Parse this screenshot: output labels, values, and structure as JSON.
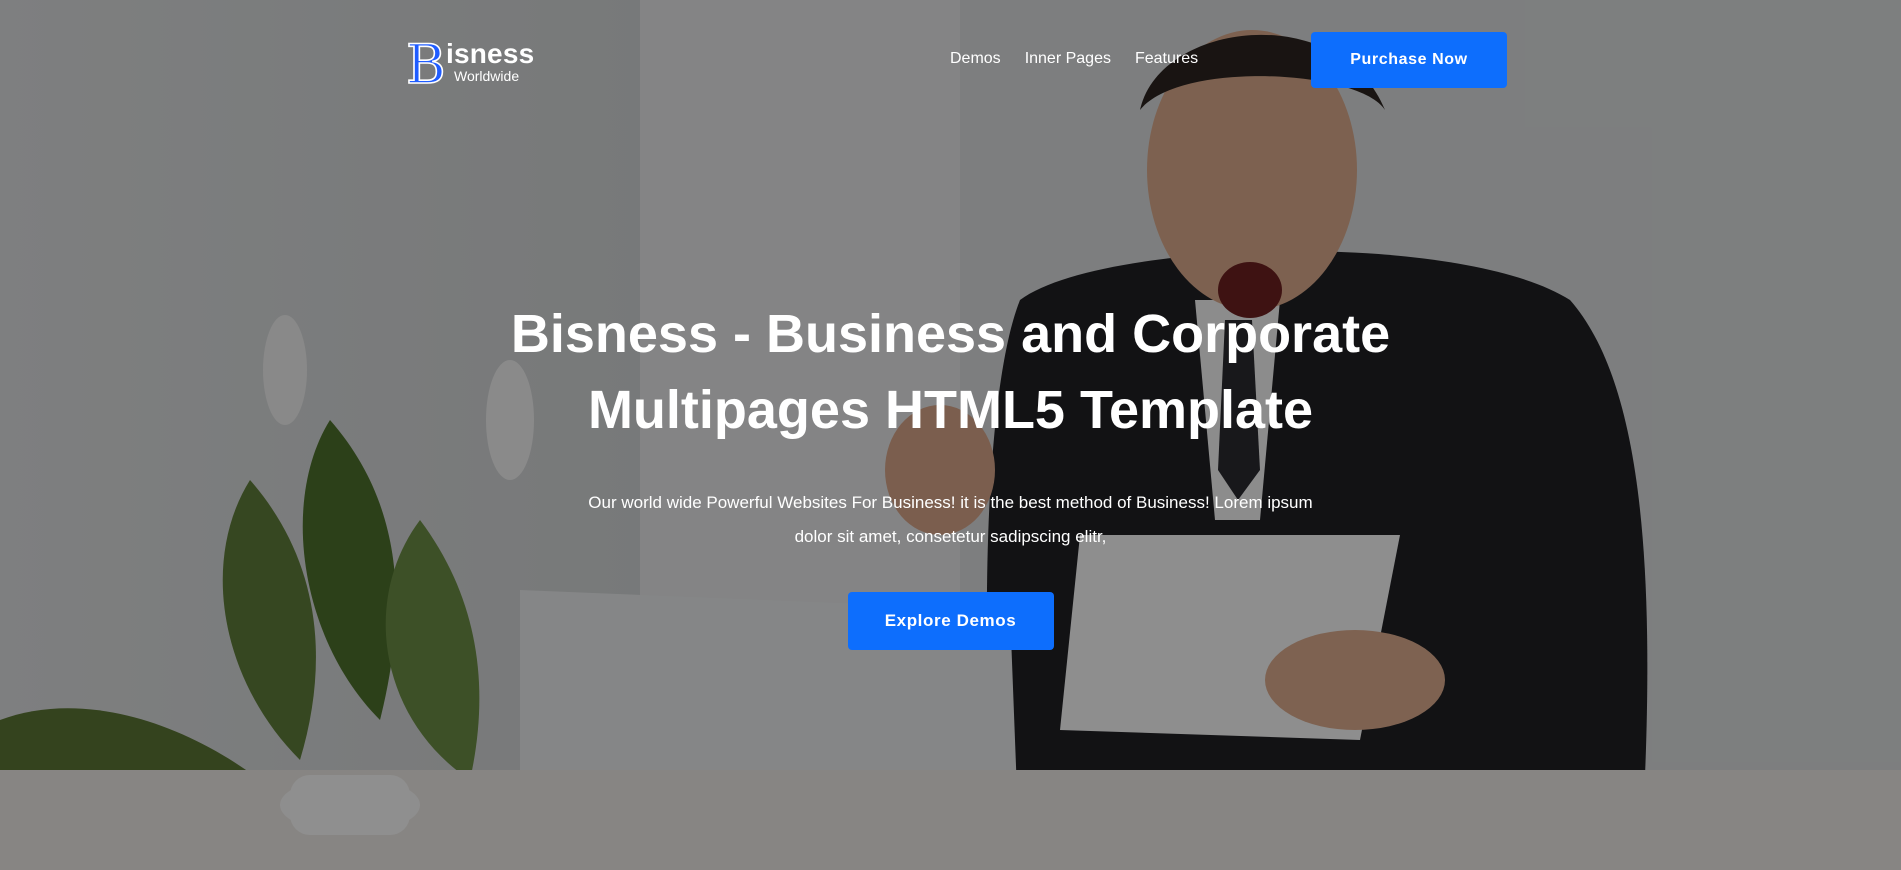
{
  "header": {
    "logo": {
      "title": "isness",
      "subtitle": "Worldwide",
      "mark_letter": "B"
    },
    "nav": [
      "Demos",
      "Inner Pages",
      "Features"
    ],
    "cta_label": "Purchase Now"
  },
  "hero": {
    "title_line1": "Bisness - Business and Corporate",
    "title_line2": "Multipages HTML5 Template",
    "description": "Our world wide Powerful Websites For Business! it is the best method of Business! Lorem ipsum dolor sit amet, consetetur sadipscing elitr,",
    "button_label": "Explore Demos"
  },
  "colors": {
    "accent": "#0d6efd",
    "text": "#ffffff"
  }
}
